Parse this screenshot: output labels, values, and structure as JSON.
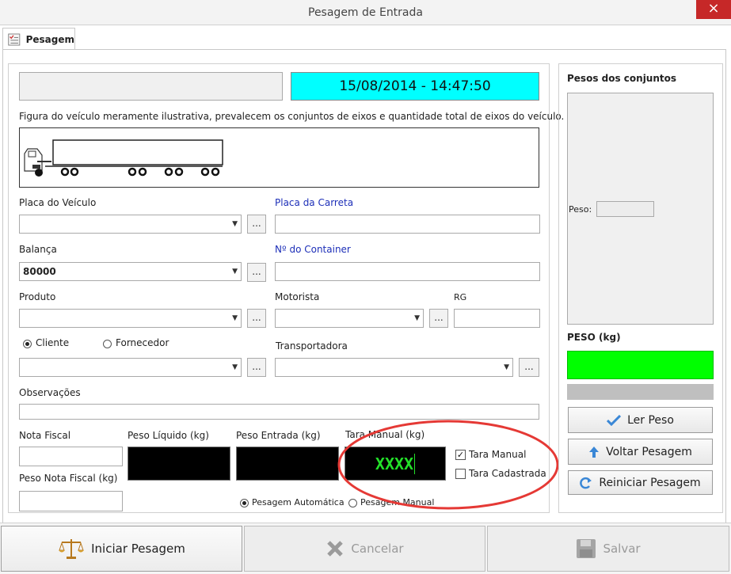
{
  "window": {
    "title": "Pesagem de Entrada",
    "close_glyph": "×",
    "accent": "#c62828"
  },
  "tab": {
    "label": "Pesagem"
  },
  "datetime": "15/08/2014 - 14:47:50",
  "notice": "Figura do veículo meramente ilustrativa, prevalecem os conjuntos de eixos e quantidade total de eixos do veículo.",
  "fields": {
    "placa_veiculo": {
      "label": "Placa do Veículo",
      "value": ""
    },
    "placa_carreta": {
      "label": "Placa da Carreta",
      "value": ""
    },
    "balanca": {
      "label": "Balança",
      "value": "80000"
    },
    "container": {
      "label": "Nº do Container",
      "value": ""
    },
    "produto": {
      "label": "Produto",
      "value": ""
    },
    "motorista": {
      "label": "Motorista",
      "value": ""
    },
    "rg": {
      "label": "RG",
      "value": ""
    },
    "cliente": {
      "label": "Cliente",
      "selected": true
    },
    "fornecedor": {
      "label": "Fornecedor",
      "selected": false
    },
    "cliente_combo": {
      "value": ""
    },
    "transportadora": {
      "label": "Transportadora",
      "value": ""
    },
    "observacoes": {
      "label": "Observações",
      "value": ""
    },
    "nota_fiscal": {
      "label": "Nota Fiscal",
      "value": ""
    },
    "peso_liquido": {
      "label": "Peso Líquido (kg)",
      "value": ""
    },
    "peso_entrada": {
      "label": "Peso Entrada (kg)",
      "value": ""
    },
    "tara_manual": {
      "label": "Tara Manual (kg)",
      "value": "XXXX"
    },
    "peso_nota_fiscal": {
      "label": "Peso Nota Fiscal (kg)",
      "value": ""
    },
    "chk_tara_manual": {
      "label": "Tara Manual",
      "checked": true
    },
    "chk_tara_cadastrada": {
      "label": "Tara Cadastrada",
      "checked": false
    },
    "pesagem_automatica": {
      "label": "Pesagem Automática",
      "selected": true
    },
    "pesagem_manual": {
      "label": "Pesagem Manual",
      "selected": false
    }
  },
  "ellipsis": "...",
  "right_panel": {
    "title": "Pesos dos conjuntos",
    "peso_label": "Peso:",
    "peso_kg_label": "PESO (kg)",
    "indicator_color": "#00ff00",
    "buttons": {
      "ler": "Ler Peso",
      "voltar": "Voltar Pesagem",
      "reiniciar": "Reiniciar Pesagem"
    }
  },
  "actions": {
    "iniciar": "Iniciar Pesagem",
    "cancelar": "Cancelar",
    "salvar": "Salvar"
  },
  "annotation_color": "#e53935",
  "datetime_bg": "#00ffff"
}
